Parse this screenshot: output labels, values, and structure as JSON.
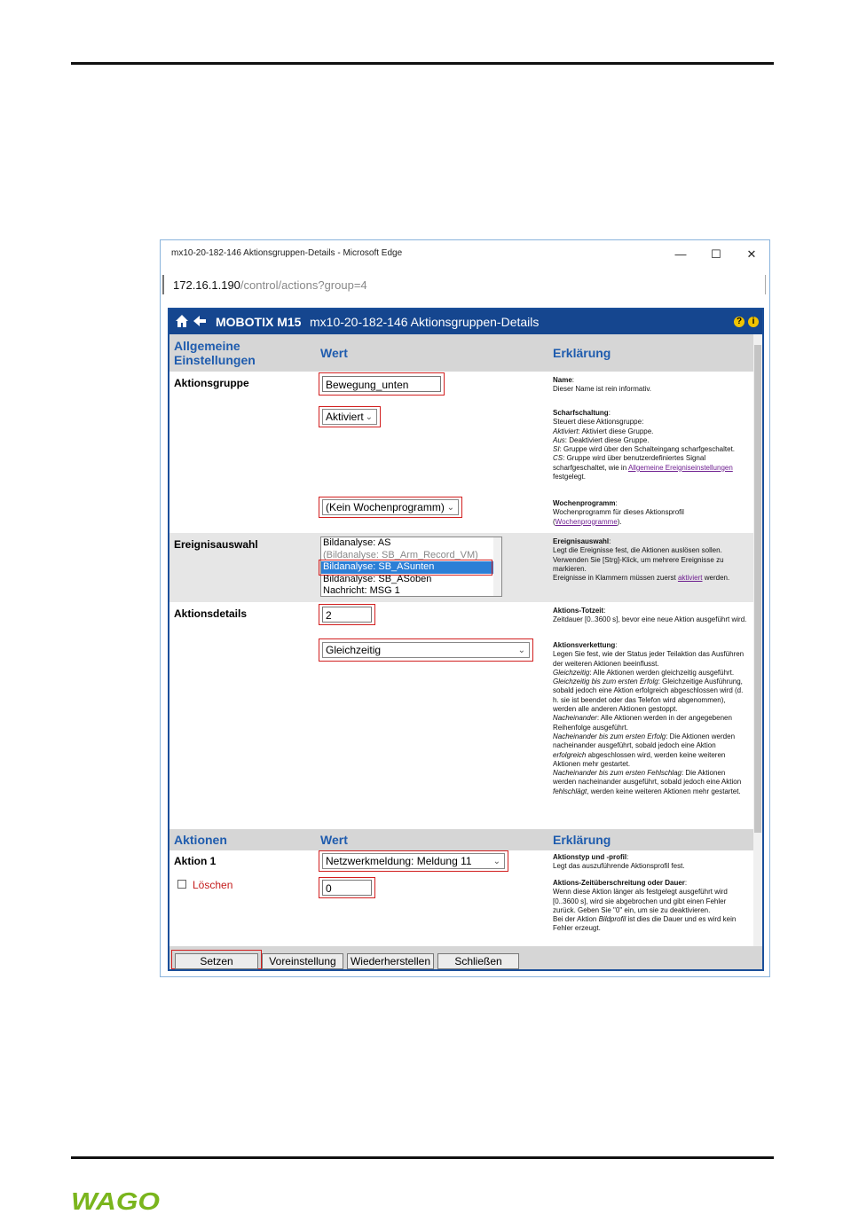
{
  "window": {
    "title": "mx10-20-182-146 Aktionsgruppen-Details - Microsoft Edge",
    "controls": {
      "minimize": "—",
      "maximize": "☐",
      "close": "✕"
    },
    "url_host": "172.16.1.190",
    "url_path": "/control/actions?group=4"
  },
  "header": {
    "brand": "MOBOTIX M15",
    "title": "mx10-20-182-146 Aktionsgruppen-Details",
    "help_icon": "?",
    "info_icon": "i"
  },
  "section1": {
    "col1": "Allgemeine Einstellungen",
    "col2": "Wert",
    "col3": "Erklärung"
  },
  "aktionsgruppe": {
    "label": "Aktionsgruppe",
    "name_value": "Bewegung_unten",
    "arming_value": "Aktiviert",
    "schedule_value": "(Kein Wochenprogramm)"
  },
  "expl_name": {
    "title": "Name",
    "text": "Dieser Name ist rein informativ."
  },
  "expl_arming": {
    "title": "Scharfschaltung",
    "intro": "Steuert diese Aktionsgruppe:",
    "a1": "Aktiviert",
    "a1t": ": Aktiviert diese Gruppe.",
    "a2": "Aus",
    "a2t": ": Deaktiviert diese Gruppe.",
    "a3": "SI",
    "a3t": ": Gruppe wird über den Schalteingang scharfgeschaltet.",
    "a4": "CS",
    "a4t": ": Gruppe wird über benutzerdefiniertes Signal scharfgeschaltet, wie in ",
    "a4link": "Allgemeine Ereigniseinstellungen",
    "a4end": " festgelegt."
  },
  "expl_schedule": {
    "title": "Wochenprogramm",
    "text": "Wochenprogramm für dieses Aktionsprofil",
    "link": "Wochenprogramme"
  },
  "ereignis": {
    "label": "Ereignisauswahl",
    "items": [
      "Bildanalyse: AS",
      "(Bildanalyse: SB_Arm_Record_VM)",
      "Bildanalyse: SB_ASunten",
      "Bildanalyse: SB_ASoben",
      "Nachricht: MSG 1"
    ]
  },
  "expl_event": {
    "title": "Ereignisauswahl",
    "text": "Legt die Ereignisse fest, die Aktionen auslösen sollen. Verwenden Sie [Strg]-Klick, um mehrere Ereignisse zu markieren.",
    "text2": "Ereignisse in Klammern müssen zuerst ",
    "link": "aktiviert",
    "text3": " werden."
  },
  "details": {
    "label": "Aktionsdetails",
    "deadtime_value": "2",
    "chaining_value": "Gleichzeitig"
  },
  "expl_deadtime": {
    "title": "Aktions-Totzeit",
    "text": "Zeitdauer [0..3600 s], bevor eine neue Aktion ausgeführt wird."
  },
  "expl_chaining": {
    "title": "Aktionsverkettung",
    "intro": "Legen Sie fest, wie der Status jeder Teilaktion das Ausführen der weiteren Aktionen beeinflusst.",
    "m1": "Gleichzeitig",
    "m1t": ": Alle Aktionen werden gleichzeitig ausgeführt.",
    "m2": "Gleichzeitig bis zum ersten Erfolg",
    "m2t": ": Gleichzeitige Ausführung, sobald jedoch eine Aktion erfolgreich abgeschlossen wird (d. h. sie ist beendet oder das Telefon wird abgenommen), werden alle anderen Aktionen gestoppt.",
    "m3": "Nacheinander",
    "m3t": ": Alle Aktionen werden in der angegebenen Reihenfolge ausgeführt.",
    "m4": "Nacheinander bis zum ersten Erfolg",
    "m4t": ": Die Aktionen werden nacheinander ausgeführt, sobald jedoch eine Aktion ",
    "m4em": "erfolgreich",
    "m4t2": " abgeschlossen wird, werden keine weiteren Aktionen mehr gestartet.",
    "m5": "Nacheinander bis zum ersten Fehlschlag",
    "m5t": ": Die Aktionen werden nacheinander ausgeführt, sobald jedoch eine Aktion ",
    "m5em": "fehlschlägt",
    "m5t2": ", werden keine weiteren Aktionen mehr gestartet."
  },
  "section2": {
    "col1": "Aktionen",
    "col2": "Wert",
    "col3": "Erklärung"
  },
  "aktion1": {
    "label": "Aktion 1",
    "delete_label": "Löschen",
    "type_value": "Netzwerkmeldung: Meldung 11",
    "timeout_value": "0"
  },
  "expl_actiontype": {
    "title": "Aktionstyp und -profil",
    "text": "Legt das auszuführende Aktionsprofil fest."
  },
  "expl_timeout": {
    "title": "Aktions-Zeitüberschreitung oder Dauer",
    "text": "Wenn diese Aktion länger als festgelegt ausgeführt wird [0..3600 s], wird sie abgebrochen und gibt einen Fehler zurück. Geben Sie \"0\" ein, um sie zu deaktivieren.",
    "text2": "Bei der Aktion ",
    "em": "Bildprofil",
    "text3": " ist dies die Dauer und es wird kein Fehler erzeugt."
  },
  "footer": {
    "set": "Setzen",
    "default": "Voreinstellung",
    "restore": "Wiederherstellen",
    "close": "Schließen"
  },
  "logo": {
    "text": "WAGO",
    "color": "#7ab51d"
  },
  "colors": {
    "header": "#15468f",
    "section": "#d6d6d6",
    "accent": "#1f5cae",
    "highlight": "#d21f1f"
  }
}
